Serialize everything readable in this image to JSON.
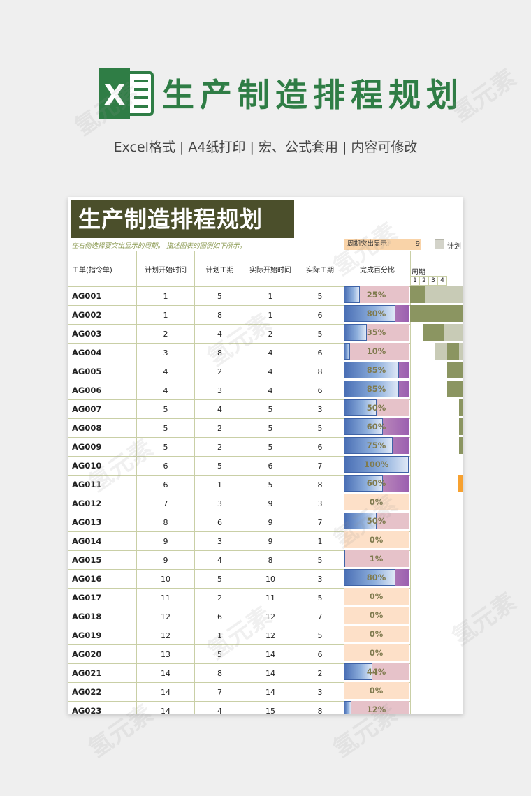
{
  "hero": {
    "logo_letter": "X",
    "title": "生产制造排程规划"
  },
  "subtitle": "Excel格式 |  A4纸打印 | 宏、公式套用 | 内容可修改",
  "sheet": {
    "title": "生产制造排程规划",
    "hint": "在右侧选择要突出显示的周期。 描述图表的图例如下所示。",
    "period_label": "周期突出显示:",
    "period_value": "9",
    "legend_label": "计划",
    "headers": [
      "工单(指令单)",
      "计划开始时间",
      "计划工期",
      "实际开始时间",
      "实际工期",
      "完成百分比"
    ],
    "gantt_header": "周期",
    "gantt_numbers": [
      "1",
      "2",
      "3",
      "4"
    ],
    "rows": [
      {
        "id": "AG001",
        "ps": "1",
        "pd": "5",
        "as": "1",
        "ad": "5",
        "pct": "25%"
      },
      {
        "id": "AG002",
        "ps": "1",
        "pd": "8",
        "as": "1",
        "ad": "6",
        "pct": "80%"
      },
      {
        "id": "AG003",
        "ps": "2",
        "pd": "4",
        "as": "2",
        "ad": "5",
        "pct": "35%"
      },
      {
        "id": "AG004",
        "ps": "3",
        "pd": "8",
        "as": "4",
        "ad": "6",
        "pct": "10%"
      },
      {
        "id": "AG005",
        "ps": "4",
        "pd": "2",
        "as": "4",
        "ad": "8",
        "pct": "85%"
      },
      {
        "id": "AG006",
        "ps": "4",
        "pd": "3",
        "as": "4",
        "ad": "6",
        "pct": "85%"
      },
      {
        "id": "AG007",
        "ps": "5",
        "pd": "4",
        "as": "5",
        "ad": "3",
        "pct": "50%"
      },
      {
        "id": "AG008",
        "ps": "5",
        "pd": "2",
        "as": "5",
        "ad": "5",
        "pct": "60%"
      },
      {
        "id": "AG009",
        "ps": "5",
        "pd": "2",
        "as": "5",
        "ad": "6",
        "pct": "75%"
      },
      {
        "id": "AG010",
        "ps": "6",
        "pd": "5",
        "as": "6",
        "ad": "7",
        "pct": "100%"
      },
      {
        "id": "AG011",
        "ps": "6",
        "pd": "1",
        "as": "5",
        "ad": "8",
        "pct": "60%"
      },
      {
        "id": "AG012",
        "ps": "7",
        "pd": "3",
        "as": "9",
        "ad": "3",
        "pct": "0%"
      },
      {
        "id": "AG013",
        "ps": "8",
        "pd": "6",
        "as": "9",
        "ad": "7",
        "pct": "50%"
      },
      {
        "id": "AG014",
        "ps": "9",
        "pd": "3",
        "as": "9",
        "ad": "1",
        "pct": "0%"
      },
      {
        "id": "AG015",
        "ps": "9",
        "pd": "4",
        "as": "8",
        "ad": "5",
        "pct": "1%"
      },
      {
        "id": "AG016",
        "ps": "10",
        "pd": "5",
        "as": "10",
        "ad": "3",
        "pct": "80%"
      },
      {
        "id": "AG017",
        "ps": "11",
        "pd": "2",
        "as": "11",
        "ad": "5",
        "pct": "0%"
      },
      {
        "id": "AG018",
        "ps": "12",
        "pd": "6",
        "as": "12",
        "ad": "7",
        "pct": "0%"
      },
      {
        "id": "AG019",
        "ps": "12",
        "pd": "1",
        "as": "12",
        "ad": "5",
        "pct": "0%"
      },
      {
        "id": "AG020",
        "ps": "13",
        "pd": "5",
        "as": "14",
        "ad": "6",
        "pct": "0%"
      },
      {
        "id": "AG021",
        "ps": "14",
        "pd": "8",
        "as": "14",
        "ad": "2",
        "pct": "44%"
      },
      {
        "id": "AG022",
        "ps": "14",
        "pd": "7",
        "as": "14",
        "ad": "3",
        "pct": "0%"
      },
      {
        "id": "AG023",
        "ps": "14",
        "pd": "4",
        "as": "15",
        "ad": "8",
        "pct": "12%"
      }
    ]
  },
  "watermark": "氢元素",
  "colors": {
    "brand_green": "#2f7d45",
    "title_bg": "#4b4f2b",
    "plan_gray": "#c8cbb6",
    "actual_olive": "#8b9561",
    "highlight_orange": "#f7a130",
    "pct_pink": "#e6c2c9",
    "pct_purple": "#9b5fb0",
    "pct_peach": "#fde0c8"
  }
}
